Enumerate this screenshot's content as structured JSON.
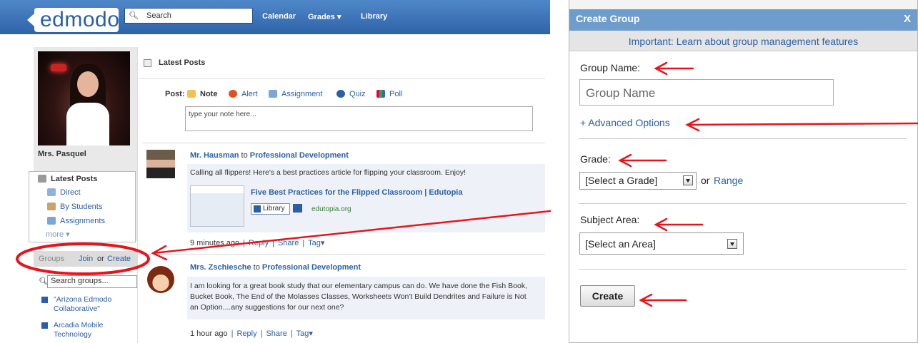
{
  "edmodo": {
    "logo": "edmodo",
    "search": {
      "placeholder": "Search"
    },
    "nav": [
      "Calendar",
      "Grades",
      "Library"
    ],
    "profile_name": "Mrs. Pasquel",
    "menu": [
      {
        "label": "Latest Posts",
        "icon": "posts-icon"
      },
      {
        "label": "Direct",
        "icon": "direct-icon"
      },
      {
        "label": "By Students",
        "icon": "students-icon"
      },
      {
        "label": "Assignments",
        "icon": "assignments-icon"
      }
    ],
    "menu_more": "more",
    "groups": {
      "label": "Groups",
      "join": "Join",
      "or": "or",
      "create": "Create",
      "search_placeholder": "Search groups..."
    },
    "group_items": [
      "\"Arizona Edmodo Collaborative\"",
      "Arcadia Mobile Technology"
    ],
    "feed": {
      "title": "Latest Posts",
      "post_label": "Post:",
      "tabs": [
        "Note",
        "Alert",
        "Assignment",
        "Quiz",
        "Poll"
      ],
      "note_placeholder": "type your note here...",
      "posts": [
        {
          "author": "Mr. Hausman",
          "to": "to",
          "group": "Professional Development",
          "body": "Calling all flippers! Here's a best practices article for flipping your classroom. Enjoy!",
          "link_title": "Five Best Practices for the Flipped Classroom | Edutopia",
          "library": "Library",
          "link_domain": "edutopia.org",
          "time": "9 minutes ago",
          "reply": "Reply",
          "share": "Share",
          "tag": "Tag"
        },
        {
          "author": "Mrs. Zschiesche",
          "to": "to",
          "group": "Professional Development",
          "body": "I am looking for a great book study that our elementary campus can do. We have done the Fish Book, Bucket Book, The End of the Molasses Classes, Worksheets Won't Build Dendrites and Failure is Not an Option....any suggestions for our next one?",
          "time": "1 hour ago",
          "reply": "Reply",
          "share": "Share",
          "tag": "Tag"
        }
      ]
    }
  },
  "dialog": {
    "title": "Create Group",
    "close": "X",
    "subtitle": "Important: Learn about group management features",
    "group_name_label": "Group Name:",
    "group_name_placeholder": "Group Name",
    "advanced": "+ Advanced Options",
    "grade_label": "Grade:",
    "grade_value": "[Select a Grade]",
    "or": "or",
    "range": "Range",
    "subject_label": "Subject Area:",
    "subject_value": "[Select an Area]",
    "create_button": "Create"
  },
  "colors": {
    "link": "#2a5fa8",
    "topbar": "#3a6fb3",
    "dialog_header": "#6e9ccd",
    "annotation": "#e8141b"
  }
}
